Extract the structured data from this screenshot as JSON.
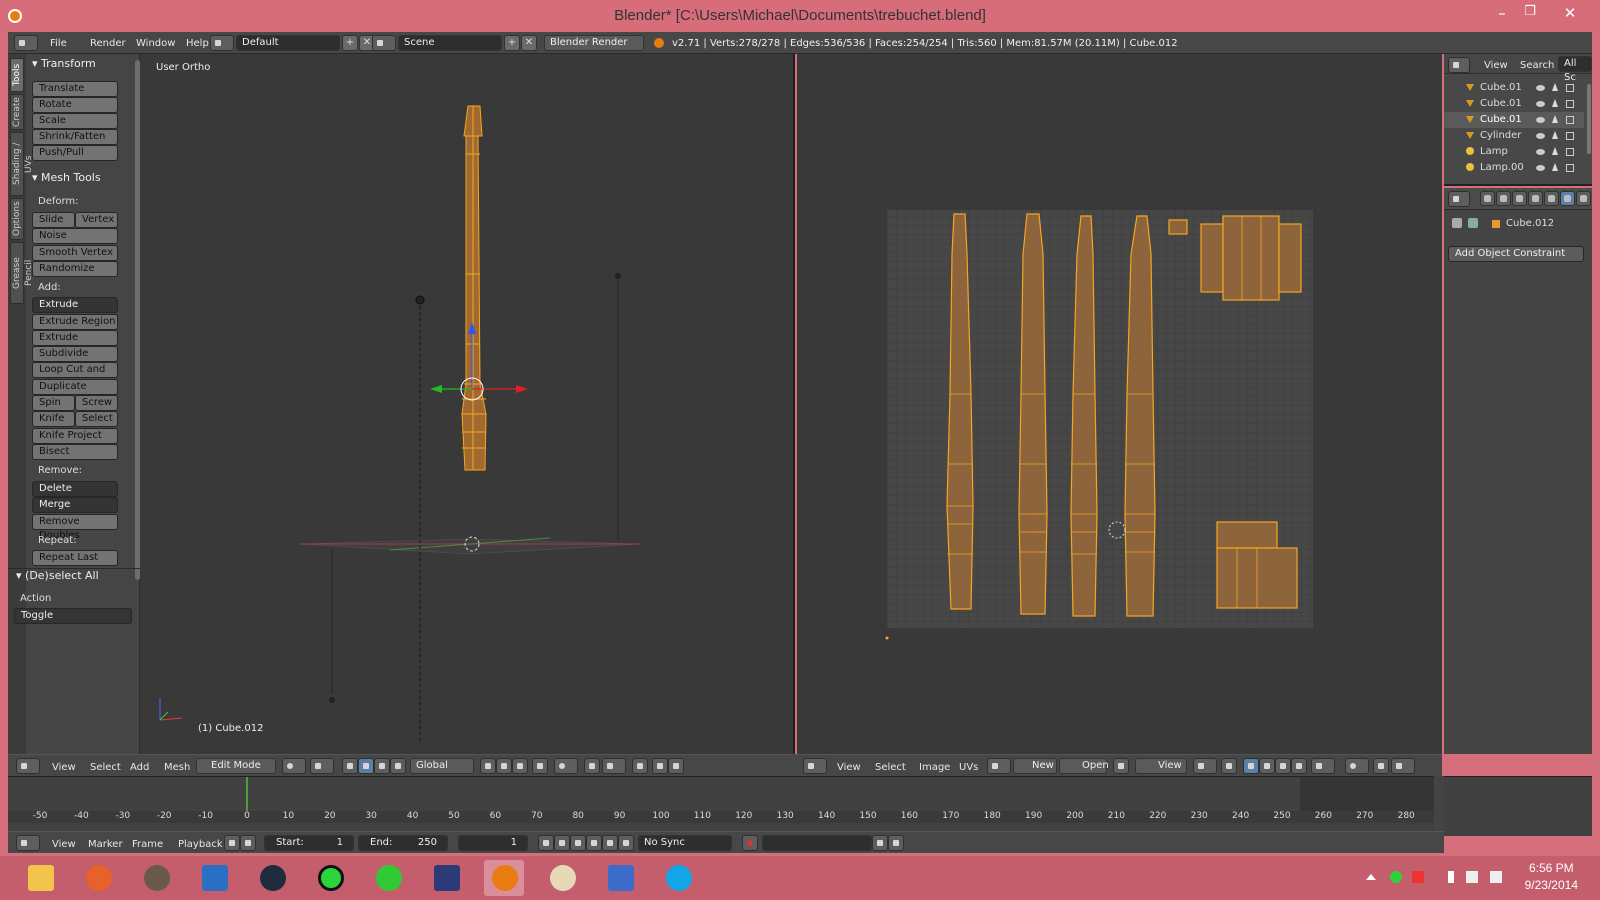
{
  "window": {
    "title": "Blender* [C:\\Users\\Michael\\Documents\\trebuchet.blend]",
    "minimize": "–",
    "maximize": "❐",
    "close": "✕"
  },
  "infobar": {
    "menus": [
      "File",
      "Render",
      "Window",
      "Help"
    ],
    "layout": "Default",
    "scene": "Scene",
    "engine": "Blender Render",
    "stats": "v2.71 | Verts:278/278 | Edges:536/536 | Faces:254/254 | Tris:560 | Mem:81.57M (20.11M) | Cube.012"
  },
  "toolshelf": {
    "tabs": [
      "Tools",
      "Create",
      "Shading / UVs",
      "Options",
      "Grease Pencil"
    ],
    "transform_title": "Transform",
    "transform_buttons": [
      "Translate",
      "Rotate",
      "Scale",
      "Shrink/Fatten",
      "Push/Pull"
    ],
    "mesh_tools_title": "Mesh Tools",
    "deform_label": "Deform:",
    "slide_edge": "Slide Ed",
    "vertex": "Vertex",
    "noise": "Noise",
    "smooth_vertex": "Smooth Vertex",
    "randomize": "Randomize",
    "add_label": "Add:",
    "extrude": "Extrude",
    "extrude_region": "Extrude Region",
    "extrude_individual": "Extrude Individual",
    "subdivide": "Subdivide",
    "loop_cut": "Loop Cut and Slide",
    "duplicate": "Duplicate",
    "spin": "Spin",
    "screw": "Screw",
    "knife": "Knife",
    "select": "Select",
    "knife_project": "Knife Project",
    "bisect": "Bisect",
    "remove_label": "Remove:",
    "delete": "Delete",
    "merge": "Merge",
    "remove_doubles": "Remove Doubles",
    "repeat_label": "Repeat:",
    "repeat_last": "Repeat Last",
    "deselect_title": "(De)select All",
    "action_label": "Action",
    "action_value": "Toggle"
  },
  "viewport3d": {
    "view_name": "User Ortho",
    "object_label": "(1) Cube.012",
    "header": {
      "menus": [
        "View",
        "Select",
        "Add",
        "Mesh"
      ],
      "mode": "Edit Mode",
      "orientation": "Global"
    }
  },
  "uv_editor": {
    "header": {
      "menus": [
        "View",
        "Select",
        "Image",
        "UVs"
      ],
      "new": "New",
      "open": "Open",
      "view": "View"
    }
  },
  "outliner": {
    "header": {
      "view": "View",
      "search": "Search",
      "filter": "All Sc"
    },
    "rows": [
      {
        "name": "Cube.01",
        "type": "mesh"
      },
      {
        "name": "Cube.01",
        "type": "mesh"
      },
      {
        "name": "Cube.01",
        "type": "mesh"
      },
      {
        "name": "Cylinder",
        "type": "mesh"
      },
      {
        "name": "Lamp",
        "type": "lamp"
      },
      {
        "name": "Lamp.00",
        "type": "lamp"
      }
    ]
  },
  "properties": {
    "object_name": "Cube.012",
    "add_constraint": "Add Object Constraint"
  },
  "timeline": {
    "ruler_ticks": [
      -50,
      -40,
      -30,
      -20,
      -10,
      0,
      10,
      20,
      30,
      40,
      50,
      60,
      70,
      80,
      90,
      100,
      110,
      120,
      130,
      140,
      150,
      160,
      170,
      180,
      190,
      200,
      210,
      220,
      230,
      240,
      250,
      260,
      270,
      280
    ],
    "current_frame_marker": 0,
    "header": {
      "menus": [
        "View",
        "Marker",
        "Frame",
        "Playback"
      ],
      "start_label": "Start:",
      "start_value": "1",
      "end_label": "End:",
      "end_value": "250",
      "current_value": "1",
      "sync": "No Sync"
    }
  },
  "taskbar": {
    "apps": [
      "file-explorer",
      "firefox",
      "gimp",
      "sketchup",
      "steam",
      "razer",
      "cloud",
      "visual-studio",
      "blender",
      "paint",
      "notepad",
      "skype"
    ],
    "active_app": "blender",
    "time": "6:56 PM",
    "date": "9/23/2014"
  },
  "colors": {
    "accent_selection": "#f5a623",
    "title_bar": "#d66d79",
    "panel_bg": "#454545",
    "viewport_bg": "#393939"
  }
}
